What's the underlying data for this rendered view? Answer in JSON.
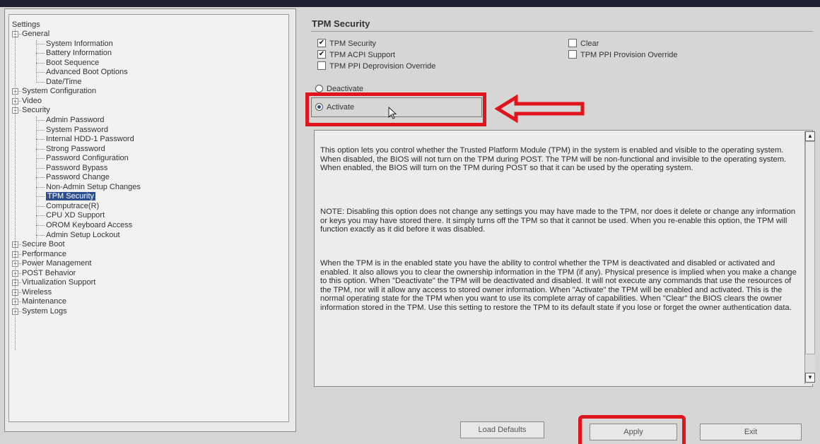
{
  "tree": {
    "root": "Settings",
    "items": [
      {
        "label": "General",
        "level": 1,
        "expander": "−"
      },
      {
        "label": "System Information",
        "level": 2
      },
      {
        "label": "Battery Information",
        "level": 2
      },
      {
        "label": "Boot Sequence",
        "level": 2
      },
      {
        "label": "Advanced Boot Options",
        "level": 2
      },
      {
        "label": "Date/Time",
        "level": 2
      },
      {
        "label": "System Configuration",
        "level": 1,
        "expander": "+"
      },
      {
        "label": "Video",
        "level": 1,
        "expander": "+"
      },
      {
        "label": "Security",
        "level": 1,
        "expander": "−"
      },
      {
        "label": "Admin Password",
        "level": 2
      },
      {
        "label": "System Password",
        "level": 2
      },
      {
        "label": "Internal HDD-1 Password",
        "level": 2
      },
      {
        "label": "Strong Password",
        "level": 2
      },
      {
        "label": "Password Configuration",
        "level": 2
      },
      {
        "label": "Password Bypass",
        "level": 2
      },
      {
        "label": "Password Change",
        "level": 2
      },
      {
        "label": "Non-Admin Setup Changes",
        "level": 2
      },
      {
        "label": "TPM Security",
        "level": 2,
        "selected": true
      },
      {
        "label": "Computrace(R)",
        "level": 2
      },
      {
        "label": "CPU XD Support",
        "level": 2
      },
      {
        "label": "OROM Keyboard Access",
        "level": 2
      },
      {
        "label": "Admin Setup Lockout",
        "level": 2
      },
      {
        "label": "Secure Boot",
        "level": 1,
        "expander": "+"
      },
      {
        "label": "Performance",
        "level": 1,
        "expander": "+"
      },
      {
        "label": "Power Management",
        "level": 1,
        "expander": "+"
      },
      {
        "label": "POST Behavior",
        "level": 1,
        "expander": "+"
      },
      {
        "label": "Virtualization Support",
        "level": 1,
        "expander": "+"
      },
      {
        "label": "Wireless",
        "level": 1,
        "expander": "+"
      },
      {
        "label": "Maintenance",
        "level": 1,
        "expander": "+"
      },
      {
        "label": "System Logs",
        "level": 1,
        "expander": "+"
      }
    ]
  },
  "section": {
    "title": "TPM Security",
    "checkboxes": {
      "tpm_security": {
        "label": "TPM Security",
        "checked": true
      },
      "tpm_acpi": {
        "label": "TPM ACPI Support",
        "checked": true
      },
      "tpm_ppi_deprovision": {
        "label": "TPM PPI Deprovision Override",
        "checked": false
      },
      "clear": {
        "label": "Clear",
        "checked": false
      },
      "tpm_ppi_provision": {
        "label": "TPM PPI Provision Override",
        "checked": false
      }
    },
    "radios": {
      "deactivate": {
        "label": "Deactivate",
        "selected": false
      },
      "activate": {
        "label": "Activate",
        "selected": true
      }
    }
  },
  "help": {
    "p1": "This option lets you control whether the Trusted Platform Module (TPM) in the system is enabled and visible to the operating system. When disabled, the BIOS will not turn on the TPM during POST. The TPM will be non-functional and invisible to the operating system. When enabled, the BIOS will turn on the TPM during POST so that it can be used by the operating system.",
    "p2": "NOTE: Disabling this option does not change any settings you may have made to the TPM, nor does it delete or change any information or keys you may have stored there. It simply turns off the TPM so that it cannot be used. When you re-enable this option, the TPM will function exactly as it did before it was disabled.",
    "p3": "When the TPM is in the enabled state you have the ability to control whether the TPM is deactivated and disabled or activated and enabled. It also allows you to clear the ownership information in the TPM (if any). Physical presence is implied when you make a change to this option. When \"Deactivate\" the TPM will be deactivated and disabled. It will not execute any commands that use the resources of the TPM, nor will it allow any access to stored owner information. When \"Activate\" the TPM will be enabled and activated. This is the normal operating state for the TPM when you want to use its complete array of capabilities. When \"Clear\" the BIOS clears the owner information stored in the TPM. Use this setting to restore the TPM to its default state if you lose or forget the owner authentication data."
  },
  "buttons": {
    "load_defaults": "Load Defaults",
    "apply": "Apply",
    "exit": "Exit"
  },
  "colors": {
    "annotation_red": "#e0141c",
    "selection_blue": "#2d4f8f"
  }
}
